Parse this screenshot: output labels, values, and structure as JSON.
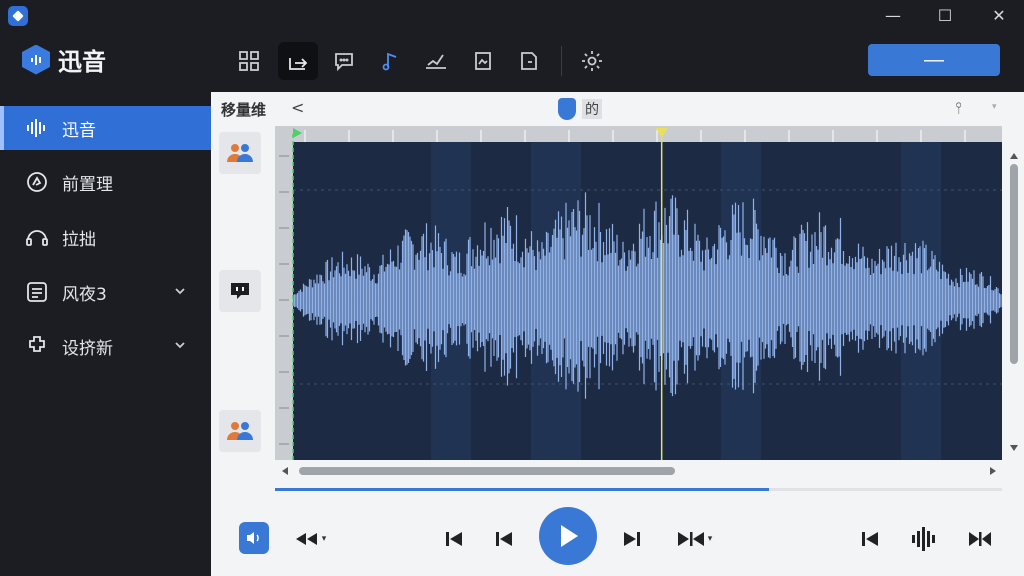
{
  "app": {
    "title": "迅音",
    "window_controls": {
      "minimize": "—",
      "maximize": "☐",
      "close": "✕"
    }
  },
  "toolbar": {
    "tools": [
      {
        "name": "layout-icon",
        "active": false
      },
      {
        "name": "export-icon",
        "active": true
      },
      {
        "name": "comment-icon",
        "active": false
      },
      {
        "name": "music-note-icon",
        "active": false
      },
      {
        "name": "curve-icon",
        "active": false
      },
      {
        "name": "frame-icon",
        "active": false
      },
      {
        "name": "document-icon",
        "active": false
      },
      {
        "name": "settings-gear-icon",
        "active": false
      }
    ],
    "primary_button_label": "—"
  },
  "sidebar": {
    "items": [
      {
        "label": "迅音",
        "icon": "waveform-icon",
        "active": true,
        "has_chevron": false
      },
      {
        "label": "前置理",
        "icon": "bell-icon",
        "active": false,
        "has_chevron": false
      },
      {
        "label": "拉拙",
        "icon": "headphone-icon",
        "active": false,
        "has_chevron": false
      },
      {
        "label": "风夜3",
        "icon": "list-icon",
        "active": false,
        "has_chevron": true
      },
      {
        "label": "设挤新",
        "icon": "puzzle-icon",
        "active": false,
        "has_chevron": true
      }
    ]
  },
  "editor": {
    "track_label": "移量维",
    "back_symbol": "<",
    "marker_label": "的",
    "right_tool_symbol": "⫯",
    "right_tool_chevron": "▾",
    "playhead_fraction": 0.52,
    "progress": 0.68,
    "horizontal_scroll_fraction": 0.52
  },
  "player": {
    "left_chevron_symbol": "▾",
    "right_chevron_symbol": "▾"
  },
  "colors": {
    "accent": "#3a78d6",
    "sidebar_bg": "#1b1d22",
    "waveform": "#8fb2ea",
    "wave_bg": "#1c2a44",
    "playhead": "#e8e05a",
    "start_marker": "#4cd06a"
  }
}
